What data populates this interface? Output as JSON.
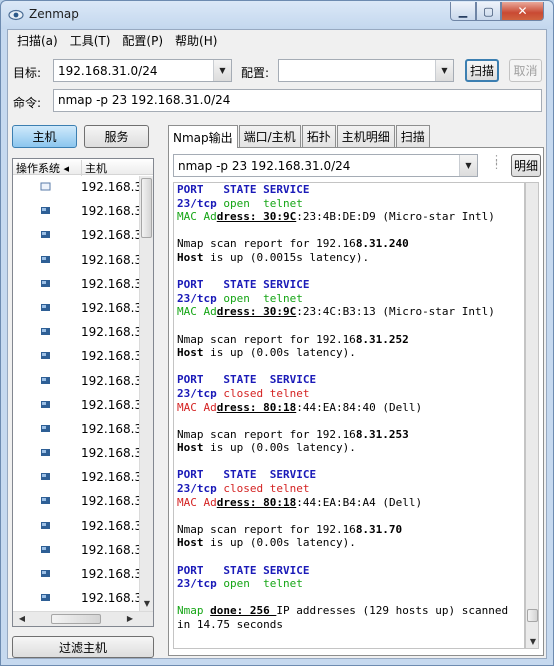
{
  "window": {
    "title": "Zenmap"
  },
  "menu": [
    "扫描(a)",
    "工具(T)",
    "配置(P)",
    "帮助(H)"
  ],
  "toolbar": {
    "target_label": "目标:",
    "target_value": "192.168.31.0/24",
    "profile_label": "配置:",
    "profile_value": "",
    "scan_button": "扫描",
    "cancel_button": "取消",
    "command_label": "命令:",
    "command_value": "nmap -p 23 192.168.31.0/24"
  },
  "left": {
    "hosts_tab": "主机",
    "services_tab": "服务",
    "col_os": "操作系统",
    "col_host": "主机",
    "hosts": [
      "192.168.3",
      "192.168.3",
      "192.168.3",
      "192.168.3",
      "192.168.3",
      "192.168.3",
      "192.168.3",
      "192.168.3",
      "192.168.3",
      "192.168.3",
      "192.168.3",
      "192.168.3",
      "192.168.3",
      "192.168.3",
      "192.168.3",
      "192.168.3",
      "192.168.3",
      "192.168.3",
      "192.168.3"
    ],
    "filter_button": "过滤主机"
  },
  "tabs": [
    "Nmap输出",
    "端口/主机",
    "拓扑",
    "主机明细",
    "扫描"
  ],
  "output": {
    "history_value": "nmap -p 23 192.168.31.0/24",
    "details_button": "明细",
    "lines": [
      [
        {
          "t": "PORT   ",
          "c": "kw"
        },
        {
          "t": "STATE ",
          "c": "kw"
        },
        {
          "t": "SERVICE",
          "c": "kw"
        }
      ],
      [
        {
          "t": "23/tcp ",
          "c": "kw"
        },
        {
          "t": "open  ",
          "c": "open"
        },
        {
          "t": "telnet",
          "c": "open"
        }
      ],
      [
        {
          "t": "MAC Ad",
          "c": "mac-open"
        },
        {
          "t": "dress: 30:9C",
          "c": "u"
        },
        {
          "t": ":23:4B:DE:D9 (Micro-star Intl)",
          "c": ""
        }
      ],
      [],
      [
        {
          "t": "Nmap scan report for 192.16",
          "c": ""
        },
        {
          "t": "8.31.240",
          "c": "bold"
        }
      ],
      [
        {
          "t": "Host",
          "c": "bold"
        },
        {
          "t": " is up (0.0015s latency).",
          "c": ""
        }
      ],
      [],
      [
        {
          "t": "PORT   ",
          "c": "kw"
        },
        {
          "t": "STATE ",
          "c": "kw"
        },
        {
          "t": "SERVICE",
          "c": "kw"
        }
      ],
      [
        {
          "t": "23/tcp ",
          "c": "kw"
        },
        {
          "t": "open  ",
          "c": "open"
        },
        {
          "t": "telnet",
          "c": "open"
        }
      ],
      [
        {
          "t": "MAC Ad",
          "c": "mac-open"
        },
        {
          "t": "dress: 30:9C",
          "c": "u"
        },
        {
          "t": ":23:4C:B3:13 (Micro-star Intl)",
          "c": ""
        }
      ],
      [],
      [
        {
          "t": "Nmap scan report for 192.16",
          "c": ""
        },
        {
          "t": "8.31.252",
          "c": "bold"
        }
      ],
      [
        {
          "t": "Host",
          "c": "bold"
        },
        {
          "t": " is up (0.00s latency).",
          "c": ""
        }
      ],
      [],
      [
        {
          "t": "PORT   ",
          "c": "kw"
        },
        {
          "t": "STATE  ",
          "c": "kw"
        },
        {
          "t": "SERVICE",
          "c": "kw"
        }
      ],
      [
        {
          "t": "23/tcp ",
          "c": "kw"
        },
        {
          "t": "closed ",
          "c": "closed"
        },
        {
          "t": "telnet",
          "c": "closed"
        }
      ],
      [
        {
          "t": "MAC Ad",
          "c": "mac-closed"
        },
        {
          "t": "dress: 80:18",
          "c": "u"
        },
        {
          "t": ":44:EA:84:40 (Dell)",
          "c": ""
        }
      ],
      [],
      [
        {
          "t": "Nmap scan report for 192.16",
          "c": ""
        },
        {
          "t": "8.31.253",
          "c": "bold"
        }
      ],
      [
        {
          "t": "Host",
          "c": "bold"
        },
        {
          "t": " is up (0.00s latency).",
          "c": ""
        }
      ],
      [],
      [
        {
          "t": "PORT   ",
          "c": "kw"
        },
        {
          "t": "STATE  ",
          "c": "kw"
        },
        {
          "t": "SERVICE",
          "c": "kw"
        }
      ],
      [
        {
          "t": "23/tcp ",
          "c": "kw"
        },
        {
          "t": "closed ",
          "c": "closed"
        },
        {
          "t": "telnet",
          "c": "closed"
        }
      ],
      [
        {
          "t": "MAC Ad",
          "c": "mac-closed"
        },
        {
          "t": "dress: 80:18",
          "c": "u"
        },
        {
          "t": ":44:EA:B4:A4 (Dell)",
          "c": ""
        }
      ],
      [],
      [
        {
          "t": "Nmap scan report for 192.16",
          "c": ""
        },
        {
          "t": "8.31.70",
          "c": "bold"
        }
      ],
      [
        {
          "t": "Host",
          "c": "bold"
        },
        {
          "t": " is up (0.00s latency).",
          "c": ""
        }
      ],
      [],
      [
        {
          "t": "PORT   ",
          "c": "kw"
        },
        {
          "t": "STATE ",
          "c": "kw"
        },
        {
          "t": "SERVICE",
          "c": "kw"
        }
      ],
      [
        {
          "t": "23/tcp ",
          "c": "kw"
        },
        {
          "t": "open  ",
          "c": "open"
        },
        {
          "t": "telnet",
          "c": "open"
        }
      ],
      [],
      [
        {
          "t": "Nmap ",
          "c": "open"
        },
        {
          "t": "done: 256 ",
          "c": "u"
        },
        {
          "t": "IP addresses (129 hosts up) scanned",
          "c": ""
        }
      ],
      [
        {
          "t": "in 14.75 seconds",
          "c": ""
        }
      ]
    ]
  },
  "colors": {
    "keyword": "#1a1ab8",
    "open": "#15a515",
    "closed": "#d42323"
  }
}
